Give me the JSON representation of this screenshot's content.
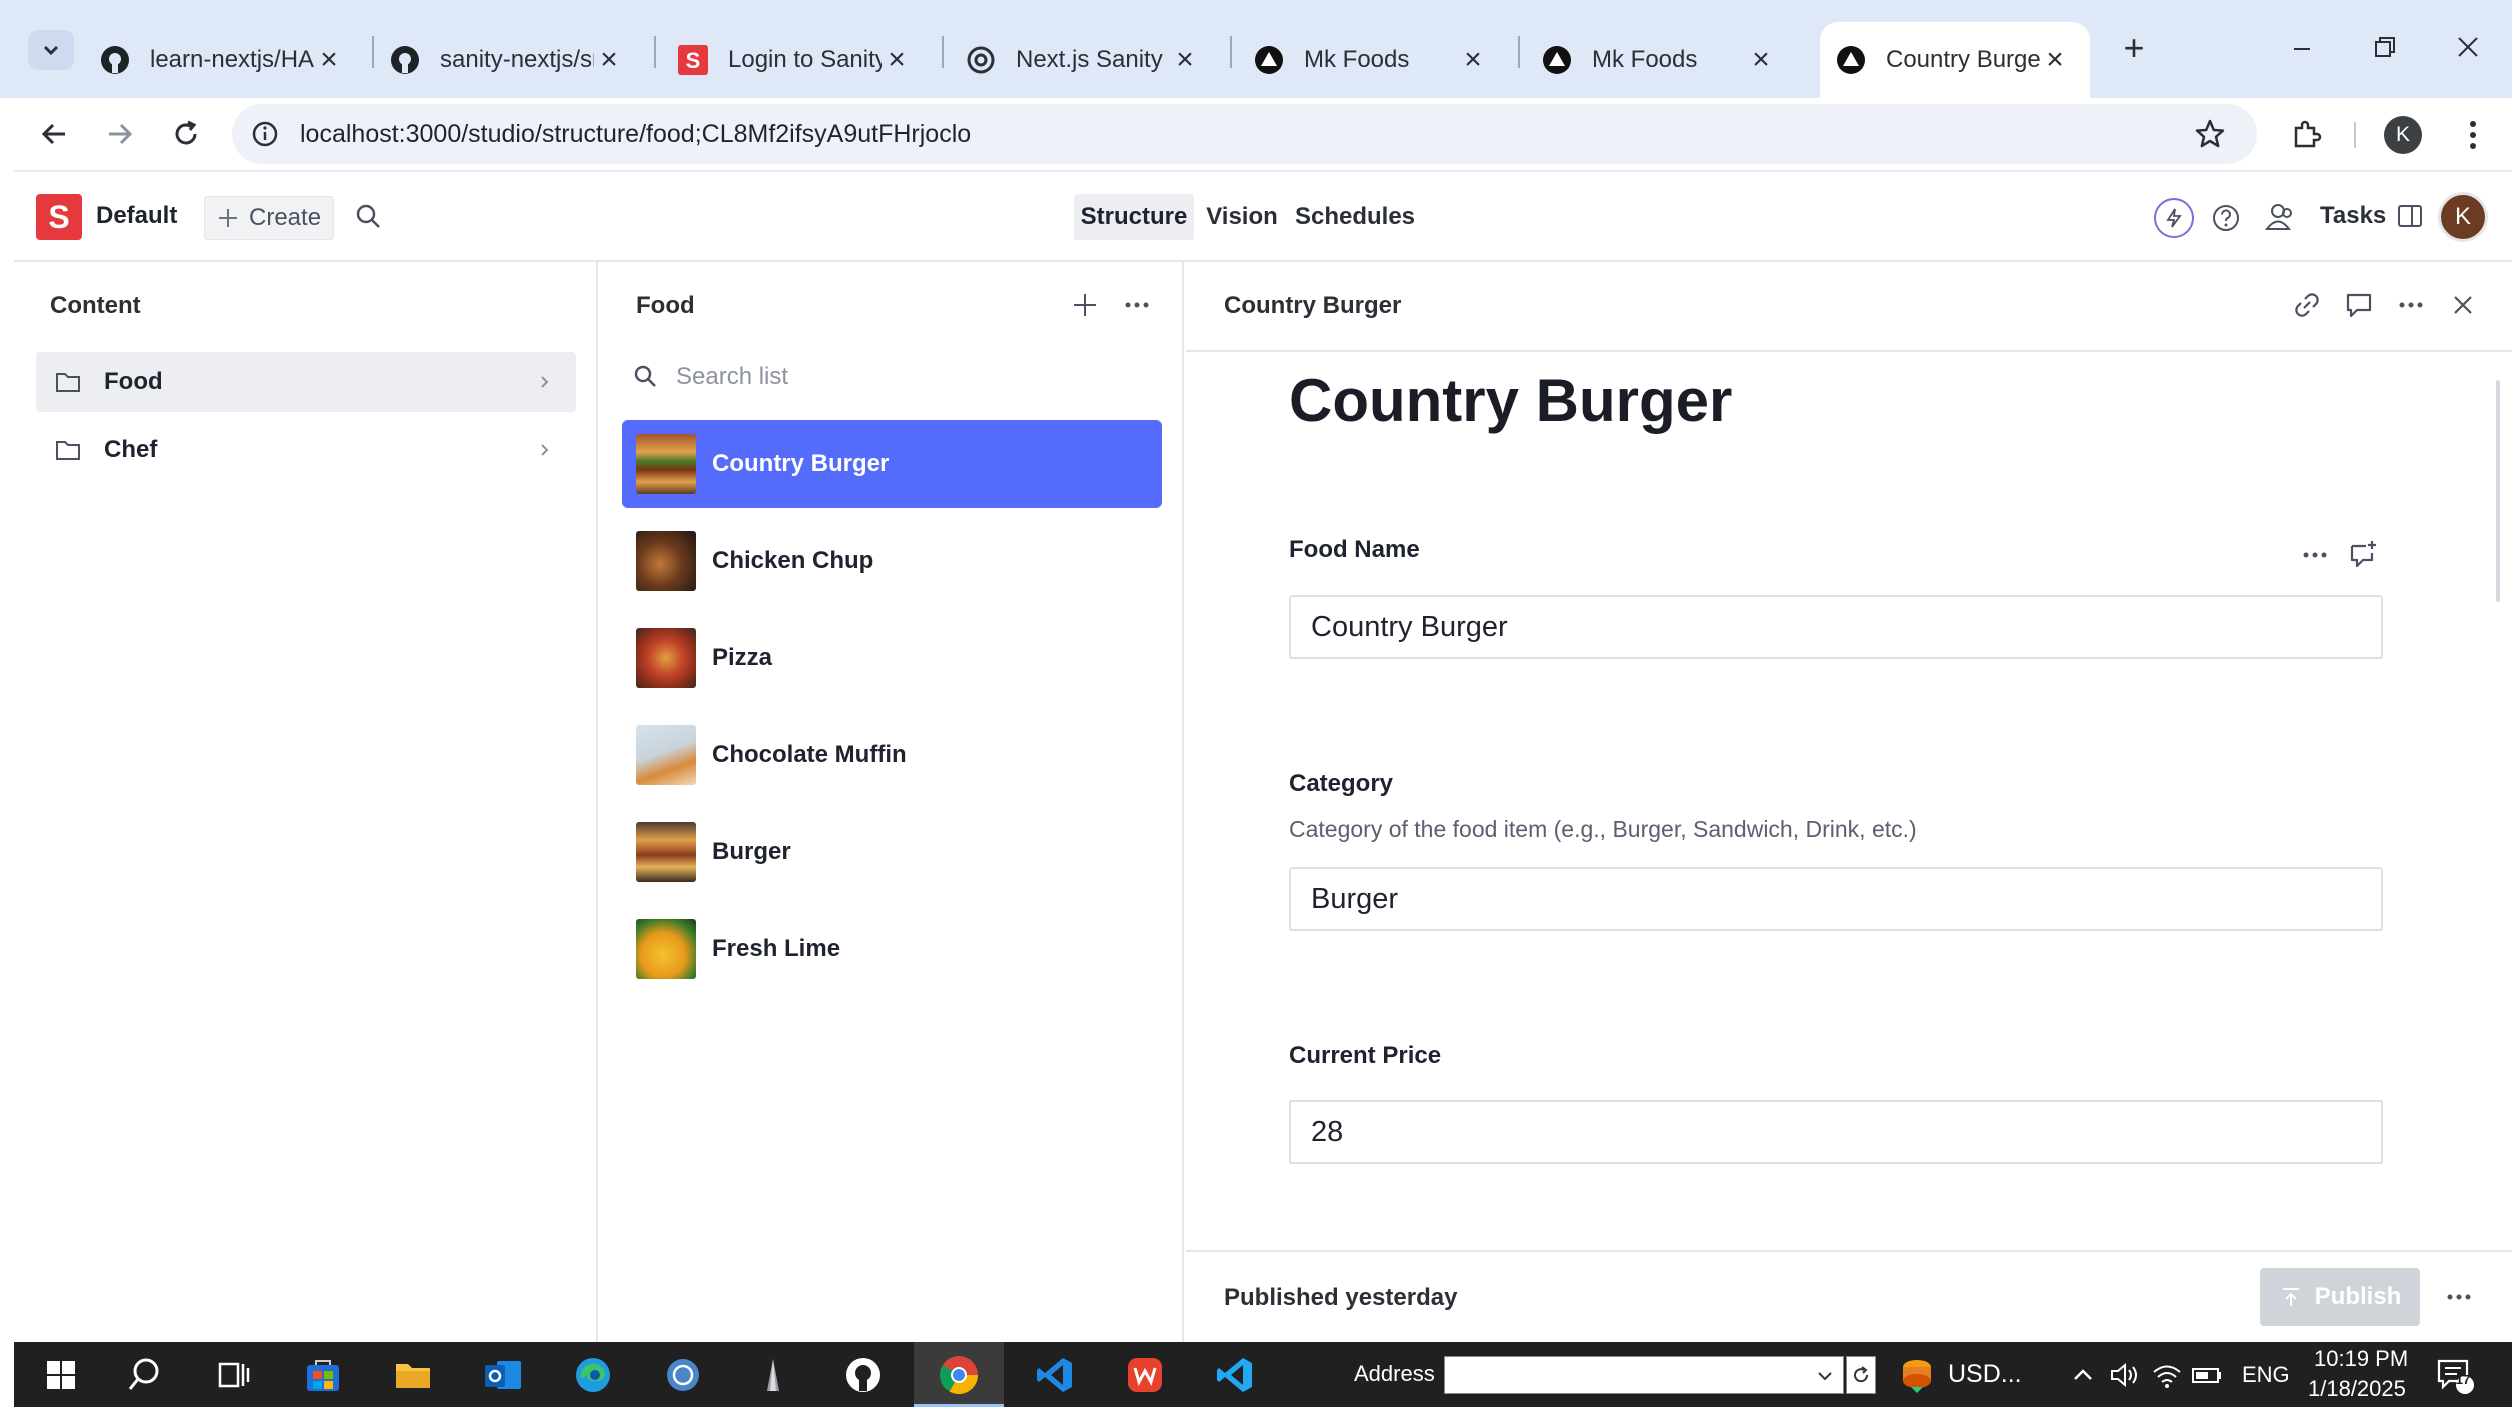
{
  "browser": {
    "tabs": [
      {
        "title": "learn-nextjs/HAC",
        "icon": "github-icon"
      },
      {
        "title": "sanity-nextjs/src",
        "icon": "github-icon"
      },
      {
        "title": "Login to Sanity.i",
        "icon": "sanity-icon"
      },
      {
        "title": "Next.js Sanity Da",
        "icon": "openai-icon"
      },
      {
        "title": "Mk Foods",
        "icon": "vercel-icon"
      },
      {
        "title": "Mk Foods",
        "icon": "vercel-icon"
      },
      {
        "title": "Country Burger |",
        "icon": "vercel-icon",
        "active": true
      }
    ],
    "new_tab": "+",
    "url": "localhost:3000/studio/structure/food;CL8Mf2ifsyA9utFHrjoclo",
    "profile_initial": "K"
  },
  "studio": {
    "logo_letter": "S",
    "workspace": "Default",
    "create_label": "Create",
    "nav": [
      "Structure",
      "Vision",
      "Schedules"
    ],
    "tasks_label": "Tasks",
    "avatar_initial": "K",
    "accent": "#556bfc"
  },
  "content_pane": {
    "title": "Content",
    "items": [
      {
        "label": "Food",
        "selected": true
      },
      {
        "label": "Chef",
        "selected": false
      }
    ]
  },
  "food_pane": {
    "title": "Food",
    "search_placeholder": "Search list",
    "items": [
      {
        "label": "Country Burger",
        "selected": true
      },
      {
        "label": "Chicken Chup"
      },
      {
        "label": "Pizza"
      },
      {
        "label": "Chocolate Muffin"
      },
      {
        "label": "Burger"
      },
      {
        "label": "Fresh Lime"
      }
    ]
  },
  "document": {
    "pane_title": "Country Burger",
    "heading": "Country Burger",
    "fields": {
      "food_name": {
        "label": "Food Name",
        "value": "Country Burger"
      },
      "category": {
        "label": "Category",
        "description": "Category of the food item (e.g., Burger, Sandwich, Drink, etc.)",
        "value": "Burger"
      },
      "current_price": {
        "label": "Current Price",
        "value": "28"
      }
    },
    "status": "Published yesterday",
    "publish_label": "Publish"
  },
  "taskbar": {
    "address_label": "Address",
    "weather": "USD...",
    "language": "ENG",
    "time": "10:19 PM",
    "date": "1/18/2025",
    "notifications": "17"
  }
}
